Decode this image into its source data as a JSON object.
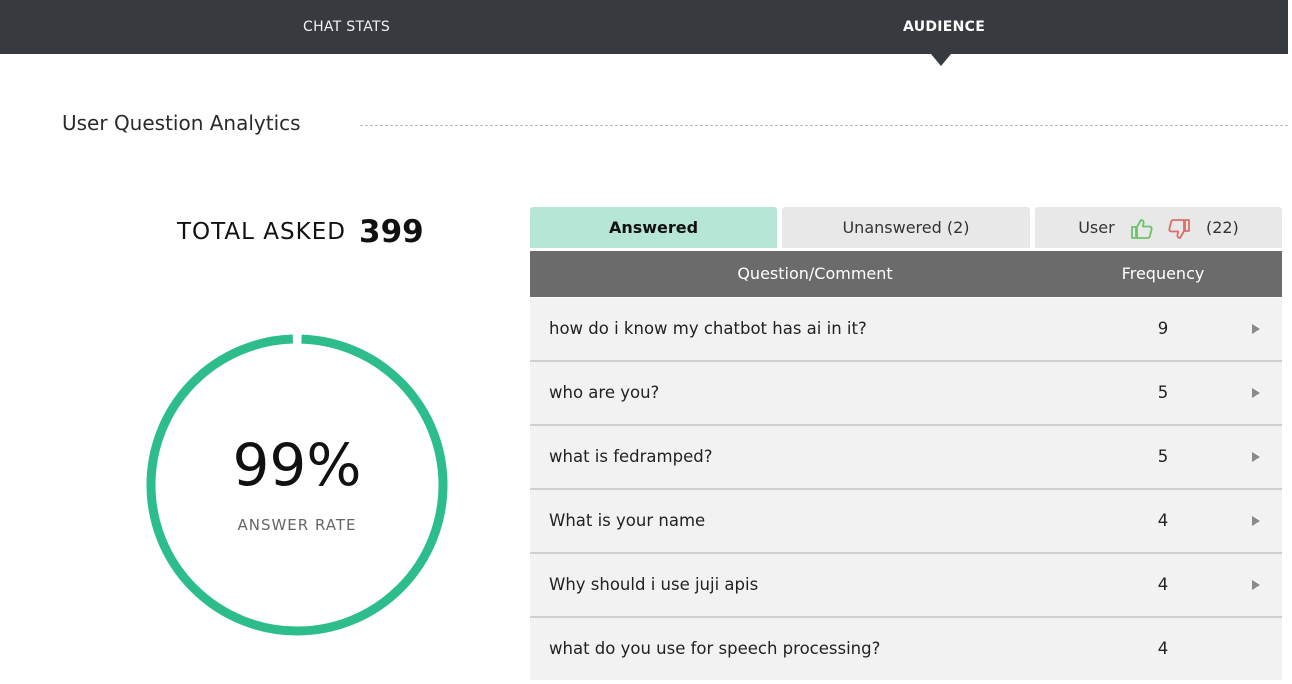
{
  "nav": {
    "tabs": [
      {
        "label": "CHAT STATS",
        "active": false
      },
      {
        "label": "AUDIENCE",
        "active": true
      }
    ]
  },
  "section": {
    "title": "User Question Analytics"
  },
  "summary": {
    "total_label": "TOTAL ASKED",
    "total_value": "399",
    "rate_value": "99%",
    "rate_label": "ANSWER RATE",
    "rate_fraction": 0.99,
    "ring_color": "#2dbd8a"
  },
  "subtabs": {
    "answered": "Answered",
    "unanswered": "Unanswered (2)",
    "user_label": "User",
    "user_count": "(22)",
    "icons": [
      "thumbs-up-icon",
      "thumbs-down-icon"
    ]
  },
  "table": {
    "headers": {
      "question": "Question/Comment",
      "frequency": "Frequency"
    },
    "rows": [
      {
        "question": "how do i know my chatbot has ai in it?",
        "frequency": "9"
      },
      {
        "question": "who are you?",
        "frequency": "5"
      },
      {
        "question": "what is fedramped?",
        "frequency": "5"
      },
      {
        "question": "What is your name",
        "frequency": "4"
      },
      {
        "question": "Why should i use juji apis",
        "frequency": "4"
      },
      {
        "question": "what do you use for speech processing?",
        "frequency": "4"
      }
    ]
  },
  "colors": {
    "nav_bg": "#373a3f",
    "accent": "#2dbd8a",
    "active_tab": "#b6e6d5",
    "thumb_up": "#6cc26a",
    "thumb_down": "#e06a6a"
  }
}
